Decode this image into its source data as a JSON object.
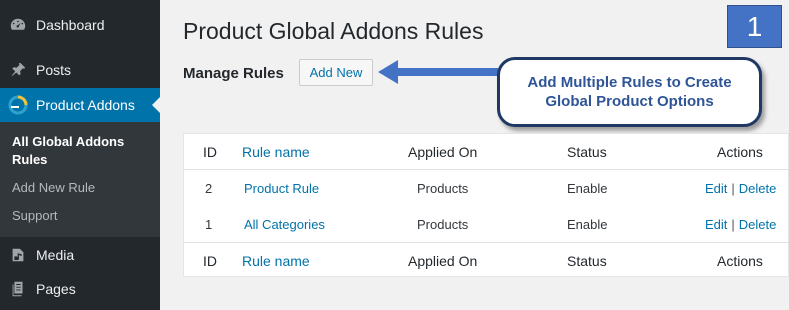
{
  "sidebar": {
    "items": [
      {
        "label": "Dashboard",
        "icon": "dashboard-icon"
      },
      {
        "label": "Posts",
        "icon": "pin-icon"
      },
      {
        "label": "Product Addons",
        "icon": "addons-icon"
      },
      {
        "label": "Media",
        "icon": "media-icon"
      },
      {
        "label": "Pages",
        "icon": "pages-icon"
      }
    ],
    "submenu": [
      {
        "label": "All Global Addons Rules"
      },
      {
        "label": "Add New Rule"
      },
      {
        "label": "Support"
      }
    ]
  },
  "header": {
    "title": "Product Global Addons Rules",
    "badge": "1"
  },
  "toolbar": {
    "manage_label": "Manage Rules",
    "add_new_label": "Add New"
  },
  "callout": {
    "line1": "Add Multiple Rules to Create",
    "line2": "Global Product Options"
  },
  "table": {
    "columns": {
      "id": "ID",
      "rule_name": "Rule name",
      "applied_on": "Applied On",
      "status": "Status",
      "actions": "Actions"
    },
    "rows": [
      {
        "id": "2",
        "rule_name": "Product Rule",
        "applied_on": "Products",
        "status": "Enable",
        "edit": "Edit",
        "sep": "|",
        "delete": "Delete"
      },
      {
        "id": "1",
        "rule_name": "All Categories",
        "applied_on": "Products",
        "status": "Enable",
        "edit": "Edit",
        "sep": "|",
        "delete": "Delete"
      }
    ]
  },
  "colors": {
    "sidebar_bg": "#23282d",
    "active_bg": "#0073aa",
    "link": "#0073aa",
    "badge_bg": "#4472c4",
    "callout_border": "#1f3864",
    "callout_text": "#2f5597"
  }
}
